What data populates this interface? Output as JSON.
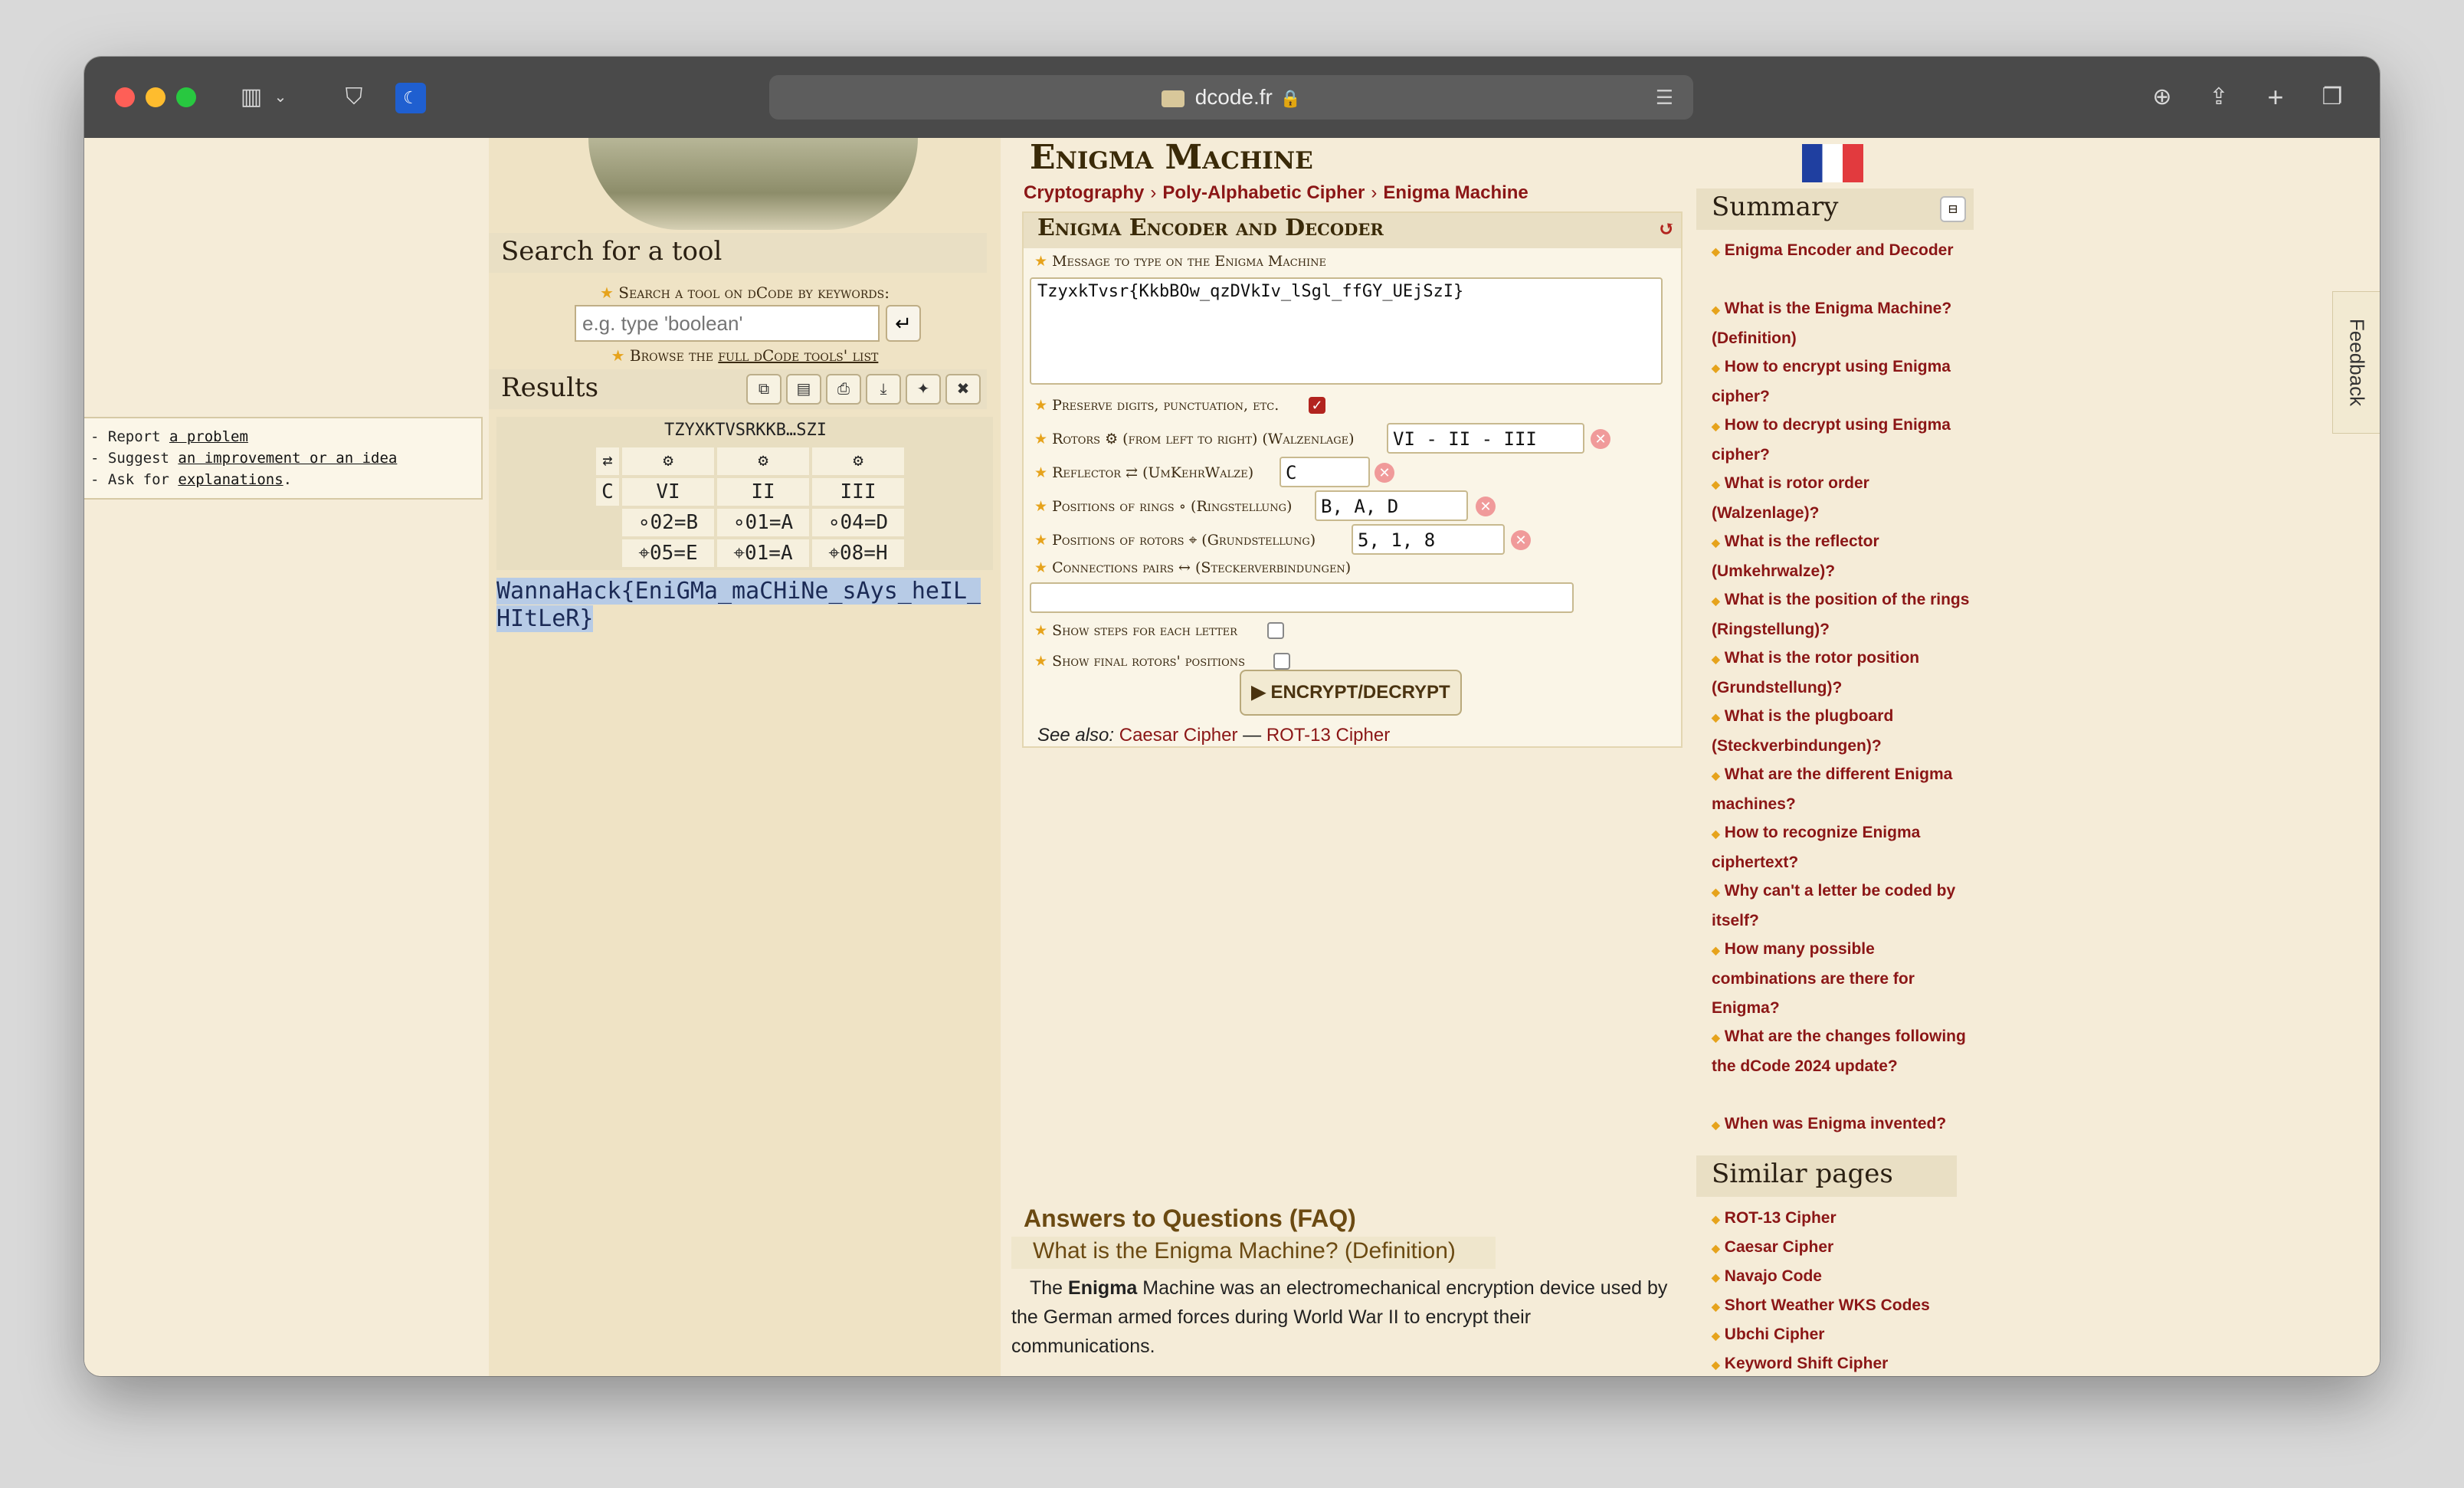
{
  "browser": {
    "url": "dcode.fr"
  },
  "report": {
    "line1_prefix": "- Report ",
    "line1_link": "a problem",
    "line2_prefix": "- Suggest ",
    "line2_link": "an improvement or an idea",
    "line3_prefix": "- Ask for ",
    "line3_link": "explanations",
    "line3_suffix": "."
  },
  "left": {
    "search_title": "Search for a tool",
    "search_label": "Search a tool on dCode by keywords:",
    "search_placeholder": "e.g. type 'boolean'",
    "browse_prefix": "Browse the ",
    "browse_link": "full dCode tools' list",
    "results_title": "Results",
    "results_header": "TZYXKTVSRKKB…SZI",
    "table": {
      "gear": "⚙",
      "swap": "⇄",
      "reflector": "C",
      "rotors": [
        "VI",
        "II",
        "III"
      ],
      "rings": [
        "∘02=B",
        "∘01=A",
        "∘04=D"
      ],
      "positions": [
        "⌖05=E",
        "⌖01=A",
        "⌖08=H"
      ]
    },
    "result_text": "WannaHack{EniGMa_maCHiNe_sAys_heIL_HItLeR}"
  },
  "main": {
    "title": "Enigma Machine",
    "breadcrumbs": [
      "Cryptography",
      "Poly-Alphabetic Cipher",
      "Enigma Machine"
    ],
    "tool_title": "Enigma Encoder and Decoder",
    "message_label": "Message to type on the Enigma Machine",
    "message_value": "TzyxkTvsr{KkbBOw_qzDVkIv_lSgl_ffGY_UEjSzI}",
    "preserve_label": "Preserve digits, punctuation, etc.",
    "rotors_label": "Rotors ⚙ (from left to right) (Walzenlage)",
    "rotors_value": "VI - II - III",
    "reflector_label": "Reflector ⇄ (UmKehrWalze)",
    "reflector_value": "C",
    "rings_label": "Positions of rings ∘ (Ringstellung)",
    "rings_value": "B, A, D",
    "rotorpos_label": "Positions of rotors ⌖ (Grundstellung)",
    "rotorpos_value": "5, 1, 8",
    "plugboard_label": "Connections pairs ↔ (Steckerverbindungen)",
    "plugboard_value": "",
    "steps_label": "Show steps for each letter",
    "final_label": "Show final rotors' positions",
    "button_label": "▶ ENCRYPT/DECRYPT",
    "see_also_label": "See also:",
    "see_also_links": [
      "Caesar Cipher",
      "ROT-13 Cipher"
    ],
    "see_also_sep": " — ",
    "faq_title": "Answers to Questions (FAQ)",
    "faq_question": "What is the Enigma Machine? (Definition)",
    "faq_answer_before": "The ",
    "faq_answer_bold": "Enigma",
    "faq_answer_after": " Machine was an electromechanical encryption device used by the German armed forces during World War II to encrypt their communications."
  },
  "summary": {
    "title": "Summary",
    "items": [
      "Enigma Encoder and Decoder",
      "What is the Enigma Machine? (Definition)",
      "How to encrypt using Enigma cipher?",
      "How to decrypt using Enigma cipher?",
      "What is rotor order (Walzenlage)?",
      "What is the reflector (Umkehrwalze)?",
      "What is the position of the rings (Ringstellung)?",
      "What is the rotor position (Grundstellung)?",
      "What is the plugboard (Steckverbindungen)?",
      "What are the different Enigma machines?",
      "How to recognize Enigma ciphertext?",
      "Why can't a letter be coded by itself?",
      "How many possible combinations are there for Enigma?",
      "What are the changes following the dCode 2024 update?",
      "When was Enigma invented?"
    ]
  },
  "similar": {
    "title": "Similar pages",
    "items": [
      "ROT-13 Cipher",
      "Caesar Cipher",
      "Navajo Code",
      "Short Weather WKS Codes",
      "Ubchi Cipher",
      "Keyword Shift Cipher"
    ]
  },
  "feedback_label": "Feedback"
}
